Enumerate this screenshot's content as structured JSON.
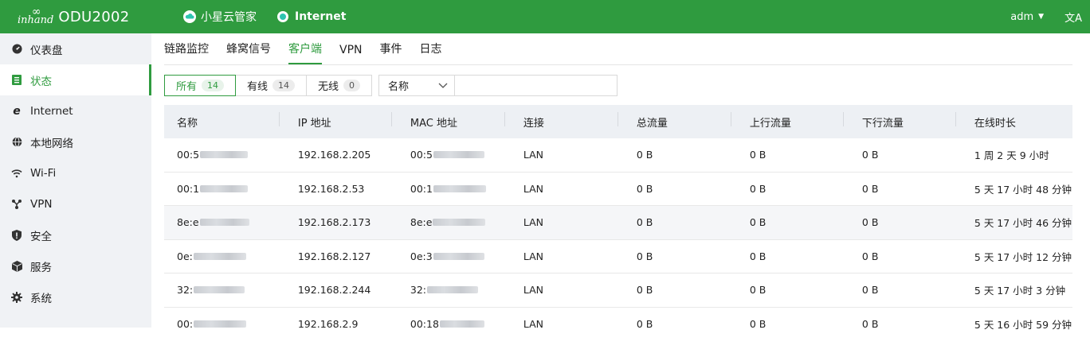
{
  "brand": {
    "logo_text": "inhand",
    "title": "ODU2002"
  },
  "top": {
    "cloud_label": "小星云管家",
    "internet_label": "Internet",
    "user": "adm",
    "translate_glyph": "文A"
  },
  "sidebar": {
    "items": [
      {
        "label": "仪表盘",
        "icon": "dashboard-icon"
      },
      {
        "label": "状态",
        "icon": "status-icon",
        "active": true
      },
      {
        "label": "Internet",
        "icon": "internet-explorer-icon"
      },
      {
        "label": "本地网络",
        "icon": "globe-icon"
      },
      {
        "label": "Wi-Fi",
        "icon": "wifi-icon"
      },
      {
        "label": "VPN",
        "icon": "vpn-icon"
      },
      {
        "label": "安全",
        "icon": "shield-icon"
      },
      {
        "label": "服务",
        "icon": "cube-icon"
      },
      {
        "label": "系统",
        "icon": "gear-icon"
      }
    ]
  },
  "tabs": [
    {
      "label": "链路监控"
    },
    {
      "label": "蜂窝信号"
    },
    {
      "label": "客户端",
      "active": true
    },
    {
      "label": "VPN"
    },
    {
      "label": "事件"
    },
    {
      "label": "日志"
    }
  ],
  "filters": {
    "segments": [
      {
        "label": "所有",
        "count": "14",
        "active": true
      },
      {
        "label": "有线",
        "count": "14"
      },
      {
        "label": "无线",
        "count": "0"
      }
    ],
    "select_value": "名称",
    "search_value": ""
  },
  "table": {
    "headers": [
      "名称",
      "IP 地址",
      "MAC 地址",
      "连接",
      "总流量",
      "上行流量",
      "下行流量",
      "在线时长"
    ],
    "rows": [
      {
        "name": "00:5",
        "ip": "192.168.2.205",
        "mac": "00:5",
        "conn": "LAN",
        "total": "0 B",
        "up": "0 B",
        "down": "0 B",
        "uptime": "1 周 2 天 9 小时"
      },
      {
        "name": "00:1",
        "ip": "192.168.2.53",
        "mac": "00:1",
        "conn": "LAN",
        "total": "0 B",
        "up": "0 B",
        "down": "0 B",
        "uptime": "5 天 17 小时 48 分钟"
      },
      {
        "name": "8e:e",
        "ip": "192.168.2.173",
        "mac": "8e:e",
        "conn": "LAN",
        "total": "0 B",
        "up": "0 B",
        "down": "0 B",
        "uptime": "5 天 17 小时 46 分钟"
      },
      {
        "name": "0e:",
        "ip": "192.168.2.127",
        "mac": "0e:3",
        "conn": "LAN",
        "total": "0 B",
        "up": "0 B",
        "down": "0 B",
        "uptime": "5 天 17 小时 12 分钟"
      },
      {
        "name": "32:",
        "ip": "192.168.2.244",
        "mac": "32:",
        "conn": "LAN",
        "total": "0 B",
        "up": "0 B",
        "down": "0 B",
        "uptime": "5 天 17 小时 3 分钟"
      },
      {
        "name": "00:",
        "ip": "192.168.2.9",
        "mac": "00:18",
        "conn": "LAN",
        "total": "0 B",
        "up": "0 B",
        "down": "0 B",
        "uptime": "5 天 16 小时 59 分钟"
      }
    ]
  },
  "colors": {
    "brand_green": "#2f9b3f",
    "teal_dot": "#2ec4b0",
    "header_bg": "#edf0f4",
    "sidebar_bg": "#f0f2f5"
  }
}
